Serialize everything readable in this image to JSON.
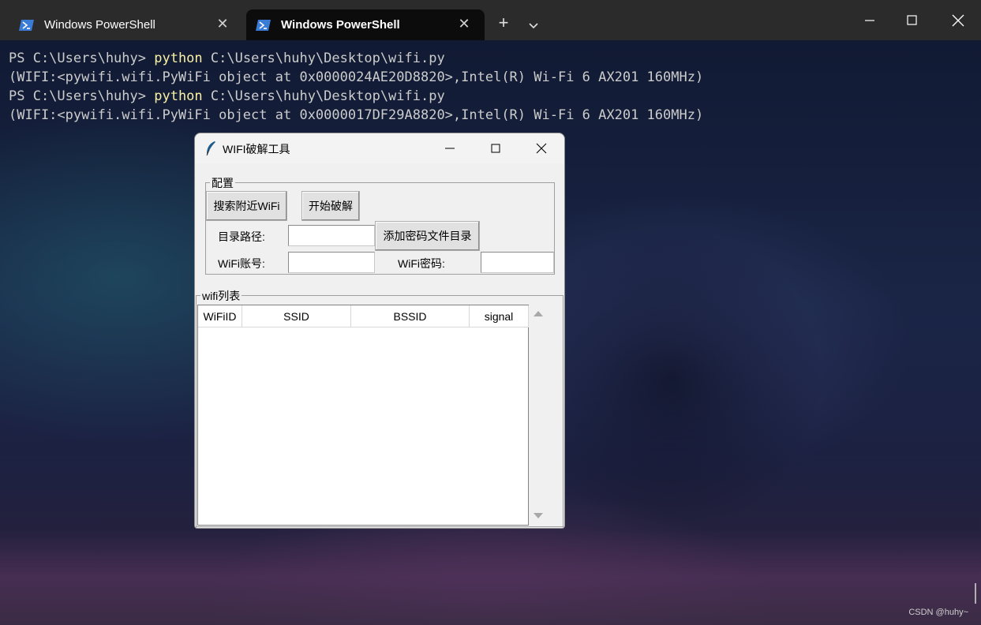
{
  "tabs": [
    {
      "label": "Windows PowerShell",
      "active": false
    },
    {
      "label": "Windows PowerShell",
      "active": true
    }
  ],
  "tab_add_label": "+",
  "terminal": {
    "lines": [
      {
        "prompt": "PS C:\\Users\\huhy> ",
        "cmd": "python",
        "args": " C:\\Users\\huhy\\Desktop\\wifi.py"
      },
      {
        "output": "(WIFI:<pywifi.wifi.PyWiFi object at 0x0000024AE20D8820>,Intel(R) Wi-Fi 6 AX201 160MHz)"
      },
      {
        "prompt": "PS C:\\Users\\huhy> ",
        "cmd": "python",
        "args": " C:\\Users\\huhy\\Desktop\\wifi.py"
      },
      {
        "output": "(WIFI:<pywifi.wifi.PyWiFi object at 0x0000017DF29A8820>,Intel(R) Wi-Fi 6 AX201 160MHz)"
      }
    ],
    "watermark": "CSDN @huhy~"
  },
  "app": {
    "title": "WIFI破解工具",
    "config": {
      "legend": "配置",
      "search_button": "搜索附近WiFi",
      "start_button": "开始破解",
      "path_label": "目录路径:",
      "path_value": "",
      "add_dict_button": "添加密码文件目录",
      "account_label": "WiFi账号:",
      "account_value": "",
      "password_label": "WiFi密码:",
      "password_value": ""
    },
    "list": {
      "legend": "wifi列表",
      "columns": [
        "WiFiID",
        "SSID",
        "BSSID",
        "signal"
      ]
    }
  },
  "colors": {
    "titlebar": "#2b2b2b",
    "terminal_text": "#cccccc",
    "command_highlight": "#f9f1a5",
    "tk_background": "#f0f0f0"
  }
}
